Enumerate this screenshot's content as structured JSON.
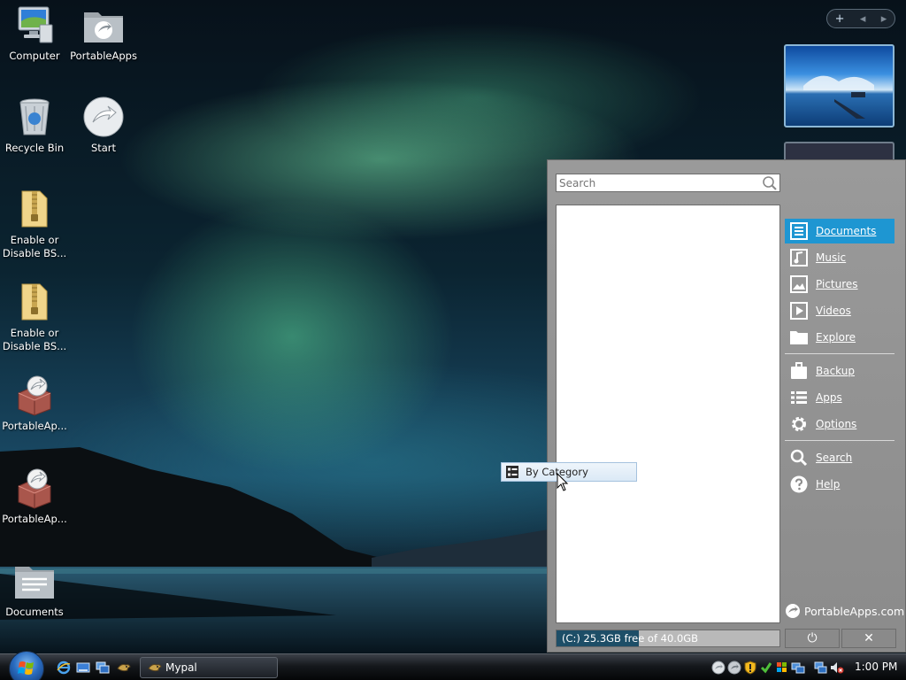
{
  "desktop": {
    "icons": [
      {
        "label": "Computer"
      },
      {
        "label": "PortableApps"
      },
      {
        "label": "Recycle Bin"
      },
      {
        "label": "Start"
      },
      {
        "label": "Enable or Disable BS..."
      },
      {
        "label": "Enable or Disable BS..."
      },
      {
        "label": "PortableAp..."
      },
      {
        "label": "PortableAp..."
      },
      {
        "label": "Documents"
      }
    ]
  },
  "gadgets": {
    "add_symbol": "+",
    "prev_symbol": "◂",
    "next_symbol": "▸"
  },
  "pa_menu": {
    "search_placeholder": "Search",
    "nav": [
      {
        "label": "Documents"
      },
      {
        "label": "Music"
      },
      {
        "label": "Pictures"
      },
      {
        "label": "Videos"
      },
      {
        "label": "Explore"
      },
      {
        "label": "Backup"
      },
      {
        "label": "Apps"
      },
      {
        "label": "Options"
      },
      {
        "label": "Search"
      },
      {
        "label": "Help"
      }
    ],
    "brand": "PortableApps.com",
    "drive_text": "(C:) 25.3GB free of 40.0GB",
    "drive_free_fraction": 0.37,
    "power_symbol": "⏻",
    "close_symbol": "✕"
  },
  "context_popup": {
    "label": "By Category"
  },
  "taskbar": {
    "window_button": "Mypal",
    "clock": "1:00 PM"
  },
  "colors": {
    "accent": "#1e96d2"
  }
}
